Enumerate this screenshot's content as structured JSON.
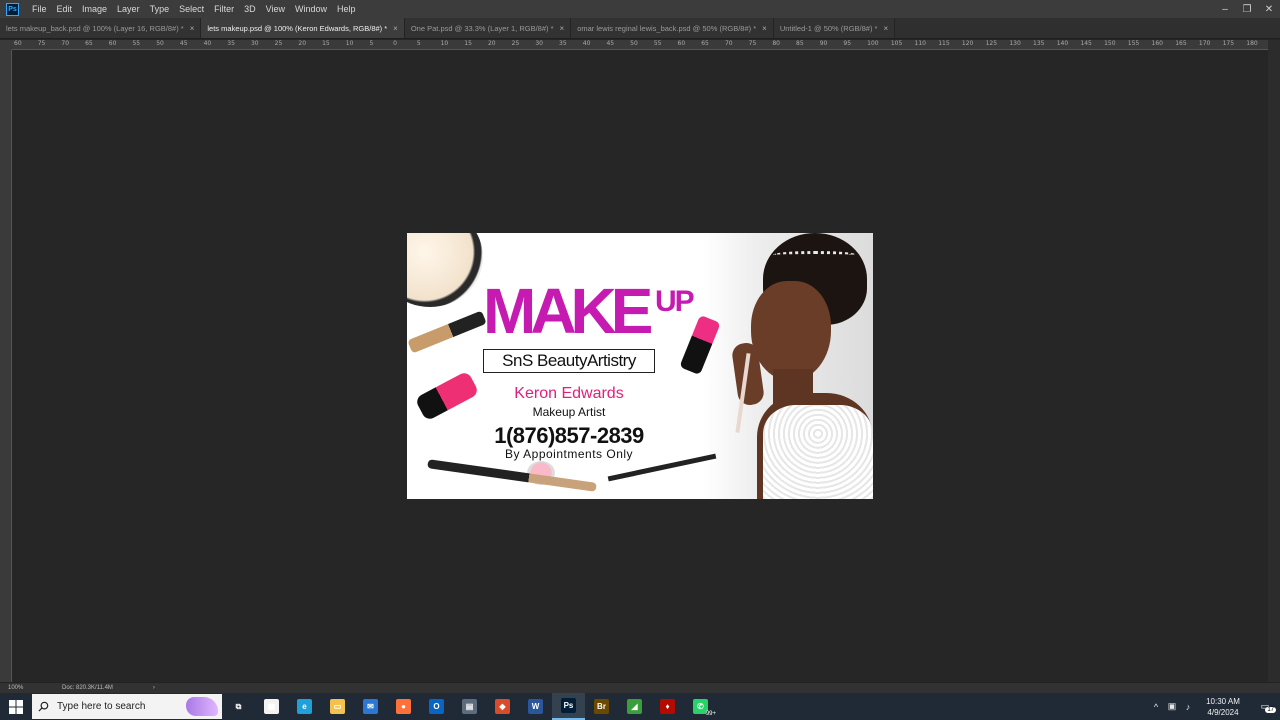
{
  "menubar": {
    "app_logo": "Ps",
    "items": [
      "File",
      "Edit",
      "Image",
      "Layer",
      "Type",
      "Select",
      "Filter",
      "3D",
      "View",
      "Window",
      "Help"
    ],
    "window_controls": {
      "minimize": "–",
      "restore": "❐",
      "close": "✕"
    }
  },
  "tabs": [
    {
      "label": "lets makeup_back.psd @ 100% (Layer 16, RGB/8#) *",
      "active": false
    },
    {
      "label": "lets makeup.psd @ 100% (Keron Edwards, RGB/8#) *",
      "active": true
    },
    {
      "label": "One Pat.psd @ 33.3% (Layer 1, RGB/8#) *",
      "active": false
    },
    {
      "label": "omar lewis reginal lewis_back.psd @ 50% (RGB/8#) *",
      "active": false
    },
    {
      "label": "Untitled-1 @ 50% (RGB/8#) *",
      "active": false
    }
  ],
  "tab_close_glyph": "×",
  "ruler": {
    "top_labels": [
      "60",
      "75",
      "70",
      "65",
      "60",
      "55",
      "50",
      "45",
      "40",
      "35",
      "30",
      "25",
      "20",
      "15",
      "10",
      "5",
      "0",
      "5",
      "10",
      "15",
      "20",
      "25",
      "30",
      "35",
      "40",
      "45",
      "50",
      "55",
      "60",
      "65",
      "70",
      "75",
      "80",
      "85",
      "90",
      "95",
      "100",
      "105",
      "110",
      "115",
      "120",
      "125",
      "130",
      "135",
      "140",
      "145",
      "150",
      "155",
      "160",
      "165",
      "170",
      "175",
      "180"
    ]
  },
  "artwork": {
    "title_make": "MAKE",
    "title_up": "UP",
    "brand": "SnS BeautyArtistry",
    "name": "Keron Edwards",
    "role": "Makeup Artist",
    "phone": "1(876)857-2839",
    "appointments": "By Appointments Only"
  },
  "statusbar": {
    "zoom": "100%",
    "doc_size": "Doc: 820.3K/11.4M",
    "arrow": "›"
  },
  "taskbar": {
    "search_placeholder": "Type here to search",
    "apps": [
      {
        "name": "task-view",
        "glyph": "⧉",
        "color": "#1f2a36",
        "active": false
      },
      {
        "name": "microsoft-store",
        "glyph": "▦",
        "color": "#f2f2f2",
        "active": false
      },
      {
        "name": "edge",
        "glyph": "e",
        "color": "#1fa0d8",
        "active": false
      },
      {
        "name": "file-explorer",
        "glyph": "▭",
        "color": "#f2c14e",
        "active": false
      },
      {
        "name": "mail",
        "glyph": "✉",
        "color": "#2b78d4",
        "active": false
      },
      {
        "name": "firefox",
        "glyph": "●",
        "color": "#ff7139",
        "active": false
      },
      {
        "name": "outlook",
        "glyph": "O",
        "color": "#0a64c4",
        "active": false
      },
      {
        "name": "calculator",
        "glyph": "▤",
        "color": "#5c6c7c",
        "active": false
      },
      {
        "name": "app-red",
        "glyph": "◆",
        "color": "#d94b2b",
        "active": false
      },
      {
        "name": "word",
        "glyph": "W",
        "color": "#2b579a",
        "active": false
      },
      {
        "name": "photoshop",
        "glyph": "Ps",
        "color": "#001e36",
        "active": true
      },
      {
        "name": "bridge",
        "glyph": "Br",
        "color": "#6a4a00",
        "active": false
      },
      {
        "name": "app-green",
        "glyph": "◢",
        "color": "#3a9e3a",
        "active": false
      },
      {
        "name": "acrobat",
        "glyph": "♦",
        "color": "#b30b00",
        "active": false
      },
      {
        "name": "whatsapp",
        "glyph": "✆",
        "color": "#25d366",
        "active": false
      }
    ],
    "whatsapp_badge": "99+",
    "tray": {
      "chevron": "^",
      "network": "▣",
      "volume": "♪",
      "time": "10:30 AM",
      "date": "4/9/2024",
      "notifications_count": "17"
    }
  }
}
